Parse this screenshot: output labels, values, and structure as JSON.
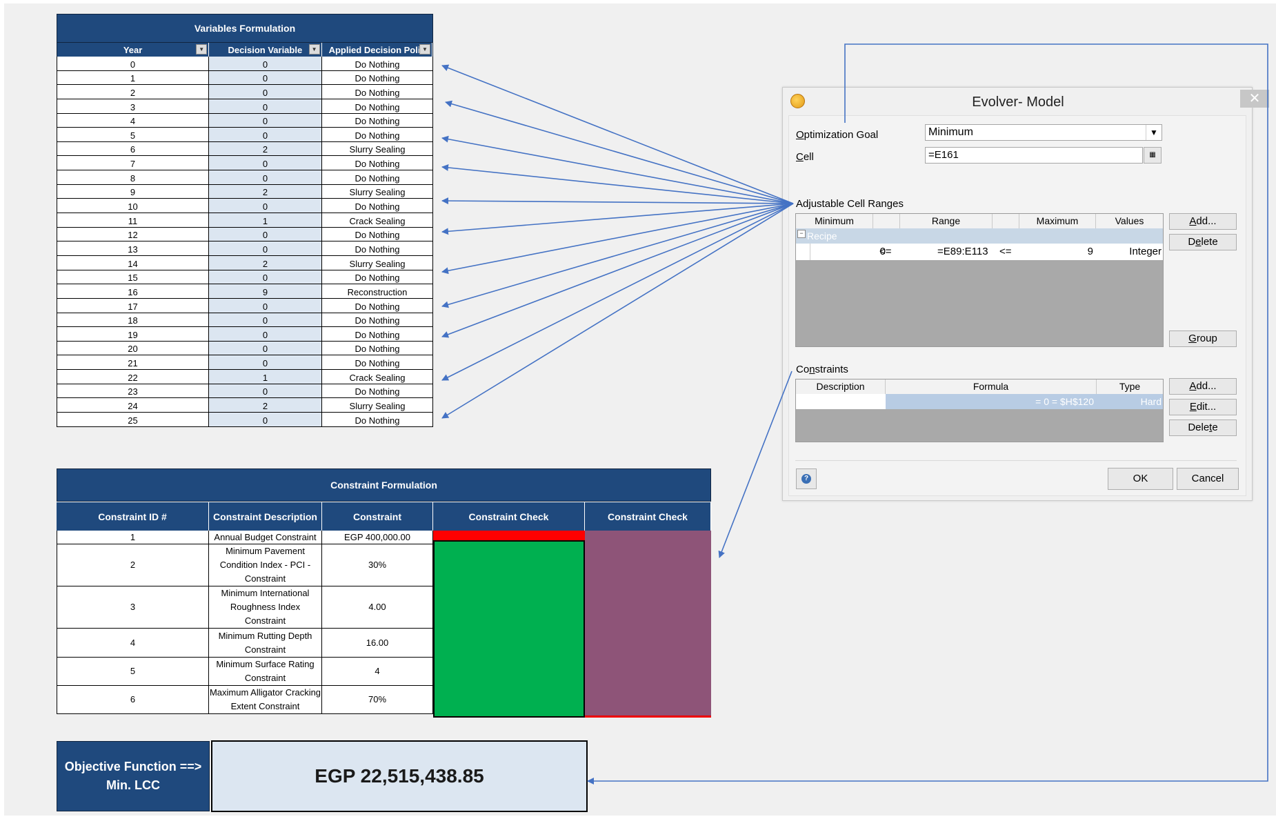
{
  "variables": {
    "title": "Variables Formulation",
    "headers": [
      "Year",
      "Decision Variable",
      "Applied Decision Poli"
    ],
    "rows": [
      [
        "0",
        "0",
        "Do Nothing"
      ],
      [
        "1",
        "0",
        "Do Nothing"
      ],
      [
        "2",
        "0",
        "Do Nothing"
      ],
      [
        "3",
        "0",
        "Do Nothing"
      ],
      [
        "4",
        "0",
        "Do Nothing"
      ],
      [
        "5",
        "0",
        "Do Nothing"
      ],
      [
        "6",
        "2",
        "Slurry Sealing"
      ],
      [
        "7",
        "0",
        "Do Nothing"
      ],
      [
        "8",
        "0",
        "Do Nothing"
      ],
      [
        "9",
        "2",
        "Slurry Sealing"
      ],
      [
        "10",
        "0",
        "Do Nothing"
      ],
      [
        "11",
        "1",
        "Crack Sealing"
      ],
      [
        "12",
        "0",
        "Do Nothing"
      ],
      [
        "13",
        "0",
        "Do Nothing"
      ],
      [
        "14",
        "2",
        "Slurry Sealing"
      ],
      [
        "15",
        "0",
        "Do Nothing"
      ],
      [
        "16",
        "9",
        "Reconstruction"
      ],
      [
        "17",
        "0",
        "Do Nothing"
      ],
      [
        "18",
        "0",
        "Do Nothing"
      ],
      [
        "19",
        "0",
        "Do Nothing"
      ],
      [
        "20",
        "0",
        "Do Nothing"
      ],
      [
        "21",
        "0",
        "Do Nothing"
      ],
      [
        "22",
        "1",
        "Crack Sealing"
      ],
      [
        "23",
        "0",
        "Do Nothing"
      ],
      [
        "24",
        "2",
        "Slurry Sealing"
      ],
      [
        "25",
        "0",
        "Do Nothing"
      ]
    ]
  },
  "constraints": {
    "title": "Constraint Formulation",
    "headers": [
      "Constraint ID #",
      "Constraint Description",
      "Constraint",
      "Constraint Check",
      "Constraint Check"
    ],
    "rows": [
      {
        "id": "1",
        "desc": "Annual Budget Constraint",
        "value": "EGP 400,000.00"
      },
      {
        "id": "2",
        "desc": "Minimum Pavement Condition Index - PCI - Constraint",
        "value": "30%"
      },
      {
        "id": "3",
        "desc": "Minimum International Roughness Index Constraint",
        "value": "4.00"
      },
      {
        "id": "4",
        "desc": "Minimum Rutting Depth Constraint",
        "value": "16.00"
      },
      {
        "id": "5",
        "desc": "Minimum Surface Rating Constraint",
        "value": "4"
      },
      {
        "id": "6",
        "desc": "Maximum Alligator Cracking Extent Constraint",
        "value": "70%"
      }
    ],
    "check_colors": {
      "pass": "#00b050",
      "fail_bar": "#ff0000",
      "second": "#8e5478"
    }
  },
  "objective": {
    "label_line1": "Objective Function ==>",
    "label_line2": "Min. LCC",
    "value": "EGP 22,515,438.85"
  },
  "dialog": {
    "title": "Evolver- Model",
    "close_glyph": "✕",
    "goal_label": "Optimization Goal",
    "goal_value": "Minimum",
    "cell_label": "Cell",
    "cell_value": "=E161",
    "adjustable_label": "Adjustable Cell Ranges",
    "adj_headers": [
      "Minimum",
      "Range",
      "Maximum",
      "Values"
    ],
    "recipe_label": "Recipe",
    "recipe_toggle": "−",
    "adj_row": {
      "min": "0",
      "op1": "<=",
      "range": "=E89:E113",
      "op2": "<=",
      "max": "9",
      "values": "Integer"
    },
    "adj_buttons": [
      "Add...",
      "Delete",
      "Group"
    ],
    "constraints_label": "Constraints",
    "con_headers": [
      "Description",
      "Formula",
      "Type"
    ],
    "con_row": {
      "desc": "",
      "formula": "= 0 = $H$120",
      "type": "Hard"
    },
    "con_buttons": [
      "Add...",
      "Edit...",
      "Delete"
    ],
    "ok": "OK",
    "cancel": "Cancel",
    "help_glyph": "?"
  },
  "colors": {
    "header_blue": "#1f497d",
    "light_blue": "#dce6f1",
    "arrow_blue": "#4472c4"
  }
}
